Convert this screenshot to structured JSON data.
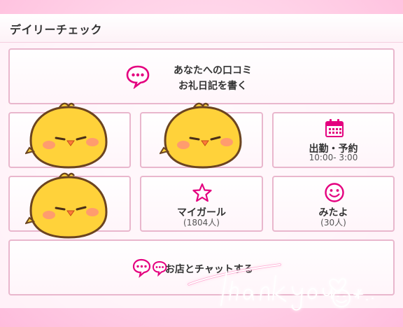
{
  "header": {
    "title": "デイリーチェック"
  },
  "cards": {
    "review": {
      "line1": "あなたへの口コミ",
      "line2": "お礼日記を書く"
    },
    "attendance": {
      "label": "出勤・予約",
      "time": "10:00- 3:00"
    },
    "mygirl": {
      "label": "マイガール",
      "count": "(1804人)"
    },
    "mitayo": {
      "label": "みたよ",
      "count": "(30人)"
    },
    "shop_chat": {
      "label": "お店とチャットする"
    }
  },
  "overlay": {
    "handwritten": "Thank you"
  },
  "colors": {
    "accent": "#e4007f",
    "border": "#e9b7cd"
  },
  "icons": [
    "chat-bubble-icon",
    "calendar-icon",
    "star-icon",
    "smile-icon",
    "chat-bubbles-icon"
  ]
}
